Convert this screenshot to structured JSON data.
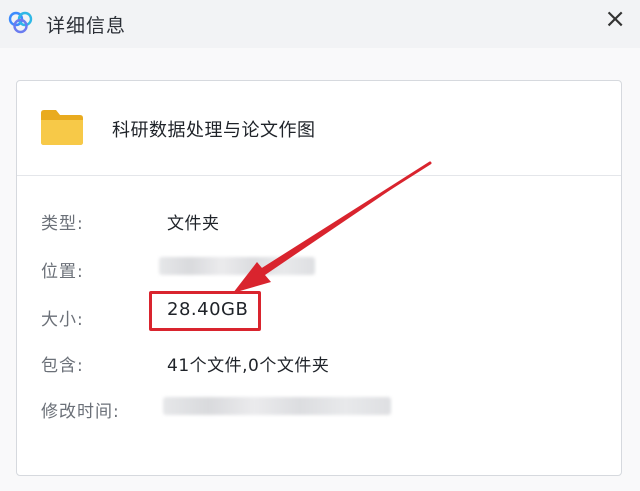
{
  "window": {
    "title": "详细信息",
    "close_glyph": "×"
  },
  "file": {
    "name": "科研数据处理与论文作图",
    "icon": "folder-icon"
  },
  "properties": {
    "type": {
      "label": "类型:",
      "value": "文件夹"
    },
    "location": {
      "label": "位置:"
    },
    "size": {
      "label": "大小:",
      "value": "28.40GB"
    },
    "contains": {
      "label": "包含:",
      "value": "41个文件,0个文件夹"
    },
    "modified": {
      "label": "修改时间:"
    }
  },
  "colors": {
    "annotation": "#d9242e",
    "folder": "#f5c342",
    "background": "#f2f3f5",
    "card": "#ffffff"
  }
}
